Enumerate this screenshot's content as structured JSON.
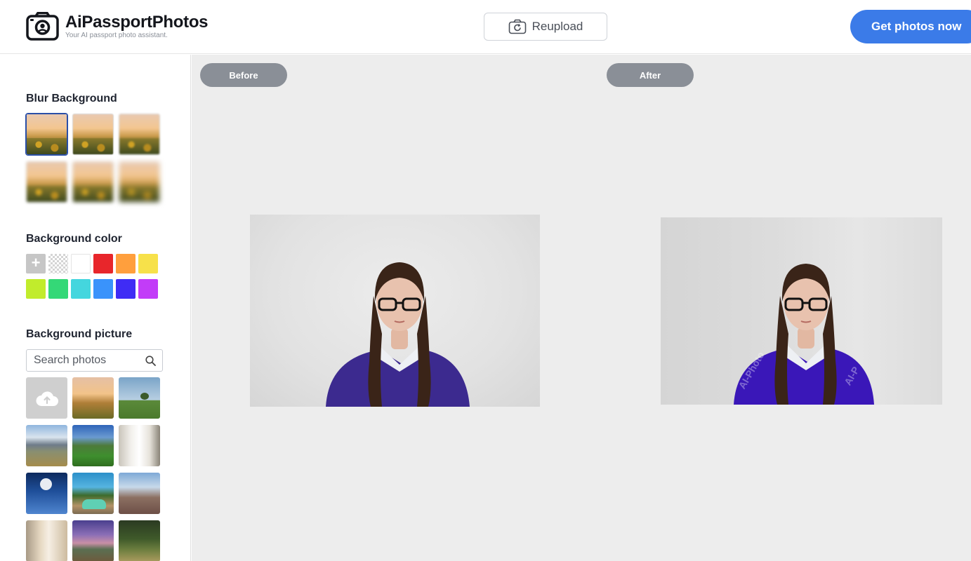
{
  "header": {
    "brand": "AiPassportPhotos",
    "tagline": "Your AI passport photo assistant.",
    "reupload_label": "Reupload",
    "cta_label": "Get photos now"
  },
  "sidebar": {
    "blur_title": "Blur Background",
    "blur_levels": [
      0,
      1,
      2,
      3,
      4,
      5
    ],
    "blur_selected_index": 0,
    "color_title": "Background color",
    "colors": [
      "add",
      "transparent",
      "#ffffff",
      "#e8262b",
      "#ff9f3d",
      "#f7e14a",
      "#c1ec2c",
      "#34d877",
      "#44d6de",
      "#3a93fb",
      "#3f2cf5",
      "#c23cf8"
    ],
    "picture_title": "Background picture",
    "search": {
      "placeholder": "Search photos",
      "value": ""
    },
    "pictures": [
      "upload-cloud",
      "balloons",
      "lone-tree",
      "mountain",
      "green-valley",
      "interior",
      "moon",
      "car-tree",
      "lavender-field",
      "window",
      "purple-sky",
      "garden-chair"
    ]
  },
  "main": {
    "before_label": "Before",
    "after_label": "After",
    "watermark_text": "AI-Photo",
    "watermark_text_2": "AI-P"
  },
  "colors": {
    "accent": "#3b7be8",
    "pill": "#8a8f97",
    "canvas": "#ededed"
  }
}
